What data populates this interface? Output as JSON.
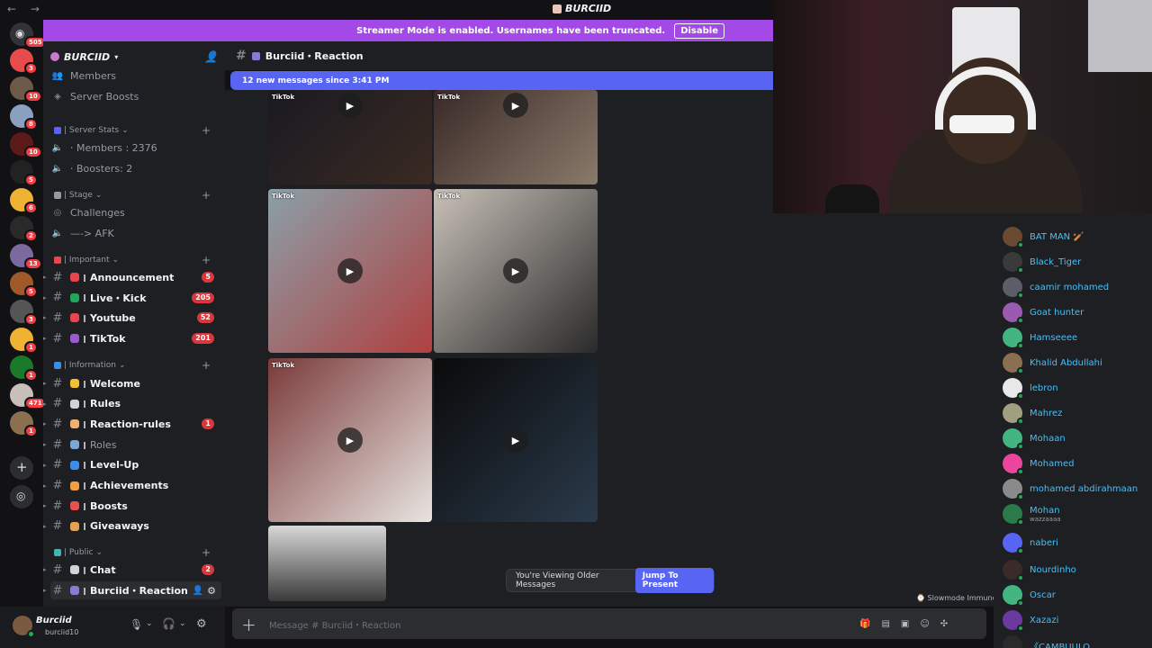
{
  "window": {
    "title": "BURCIID",
    "nav": "← →"
  },
  "banner": {
    "text": "Streamer Mode is enabled. Usernames have been truncated.",
    "button": "Disable"
  },
  "rail": {
    "home_badge": "505",
    "servers": [
      {
        "badge": "3",
        "color": "#e84b4b"
      },
      {
        "badge": "10",
        "color": "#6b5a48"
      },
      {
        "badge": "8",
        "color": "#8aa0c0"
      },
      {
        "badge": "10",
        "color": "#5c1a1a"
      },
      {
        "badge": "5",
        "color": "#222"
      },
      {
        "badge": "6",
        "color": "#f0b232"
      },
      {
        "badge": "2",
        "color": "#2a2a2a"
      },
      {
        "badge": "13",
        "color": "#7a6aa0"
      },
      {
        "badge": "5",
        "color": "#a05a2a"
      },
      {
        "badge": "3",
        "color": "#555"
      },
      {
        "badge": "1",
        "color": "#f0b232"
      },
      {
        "badge": "1",
        "color": "#1a7a2a"
      },
      {
        "badge": "471",
        "color": "#c8c0b8"
      },
      {
        "badge": "1",
        "color": "#8a7050"
      }
    ]
  },
  "sidebar": {
    "server_name": "BURCIID",
    "top_items": [
      "Members",
      "Server Boosts"
    ],
    "cat_stats": "| Server Stats",
    "stats": [
      "⋅ Members : 2376",
      "⋅ Boosters: 2"
    ],
    "cat_stage": "| Stage",
    "stage_items": [
      "Challenges",
      "—-> AFK"
    ],
    "cat_important": "| Important",
    "important": [
      {
        "label": "Announcement",
        "badge": "5",
        "color": "#e8454f"
      },
      {
        "label": "Live・Kick",
        "badge": "205",
        "color": "#23a55a"
      },
      {
        "label": "Youtube",
        "badge": "52",
        "color": "#e8454f"
      },
      {
        "label": "TikTok",
        "badge": "201",
        "color": "#9b59d0"
      }
    ],
    "cat_info": "| Information",
    "info": [
      {
        "label": "Welcome",
        "badge": "",
        "color": "#f0c232",
        "bold": true
      },
      {
        "label": "Rules",
        "badge": "",
        "color": "#cfd3da",
        "bold": true
      },
      {
        "label": "Reaction-rules",
        "badge": "1",
        "color": "#f0b070",
        "bold": true
      },
      {
        "label": "Roles",
        "badge": "",
        "color": "#7aa6d8",
        "bold": false
      },
      {
        "label": "Level-Up",
        "badge": "",
        "color": "#3b8ee8",
        "bold": true
      },
      {
        "label": "Achievements",
        "badge": "",
        "color": "#f0a040",
        "bold": true
      },
      {
        "label": "Boosts",
        "badge": "",
        "color": "#e85050",
        "bold": true
      },
      {
        "label": "Giveaways",
        "badge": "",
        "color": "#e8a050",
        "bold": true
      }
    ],
    "cat_public": "| Public",
    "public": [
      {
        "label": "Chat",
        "badge": "2",
        "color": "#cfd3da"
      },
      {
        "label": "Burciid・Reaction",
        "badge": "",
        "color": "#8a7ad0"
      }
    ]
  },
  "user": {
    "name": "Burciid",
    "tag": "burciid10"
  },
  "channel": {
    "name": "Burciid・Reaction",
    "new_messages": "12 new messages since 3:41 PM"
  },
  "tiles": [
    {
      "tk": "TikTok",
      "c1": "#1a1a22",
      "c2": "#3a2a22"
    },
    {
      "tk": "TikTok",
      "c1": "#3a2a28",
      "c2": "#8a7a6a"
    },
    {
      "tk": "TikTok",
      "c1": "#8aa0a8",
      "c2": "#b04040"
    },
    {
      "tk": "TikTok",
      "c1": "#c8c0b8",
      "c2": "#2a2a2a"
    },
    {
      "tk": "TikTok",
      "c1": "#7a3a3a",
      "c2": "#e8e4e0"
    },
    {
      "tk": "",
      "c1": "#0a0a0a",
      "c2": "#2a3a4a"
    }
  ],
  "older": {
    "text": "You're Viewing Older Messages",
    "button": "Jump To Present"
  },
  "slowmode": "Slowmode Immune",
  "composer": {
    "placeholder": "Message # Burciid・Reaction"
  },
  "members": [
    {
      "name": "BAT MAN 🏏",
      "color": "#6a4a30"
    },
    {
      "name": "Black_Tiger",
      "color": "#3a3a3a"
    },
    {
      "name": "caamir mohamed",
      "color": "#5a5e66"
    },
    {
      "name": "Goat hunter",
      "color": "#9a5ab0"
    },
    {
      "name": "Hamseeee",
      "color": "#43b581"
    },
    {
      "name": "Khalid Abdullahi",
      "color": "#8a7050"
    },
    {
      "name": "lebron",
      "color": "#e8e8e8"
    },
    {
      "name": "Mahrez",
      "color": "#a0a080"
    },
    {
      "name": "Mohaan",
      "color": "#43b581"
    },
    {
      "name": "Mohamed",
      "color": "#eb459e"
    },
    {
      "name": "mohamed abdirahmaan",
      "color": "#8a8a8a"
    },
    {
      "name": "Mohan",
      "color": "#2a7a4a",
      "sub": "wazzaaaa"
    },
    {
      "name": "naberi",
      "color": "#5865f2"
    },
    {
      "name": "Nourdinho",
      "color": "#3a2a28"
    },
    {
      "name": "Oscar",
      "color": "#43b581"
    },
    {
      "name": "Xazazi",
      "color": "#6a3aa0"
    },
    {
      "name": "《CAMBUULO...",
      "color": "#2a2a2a"
    }
  ]
}
